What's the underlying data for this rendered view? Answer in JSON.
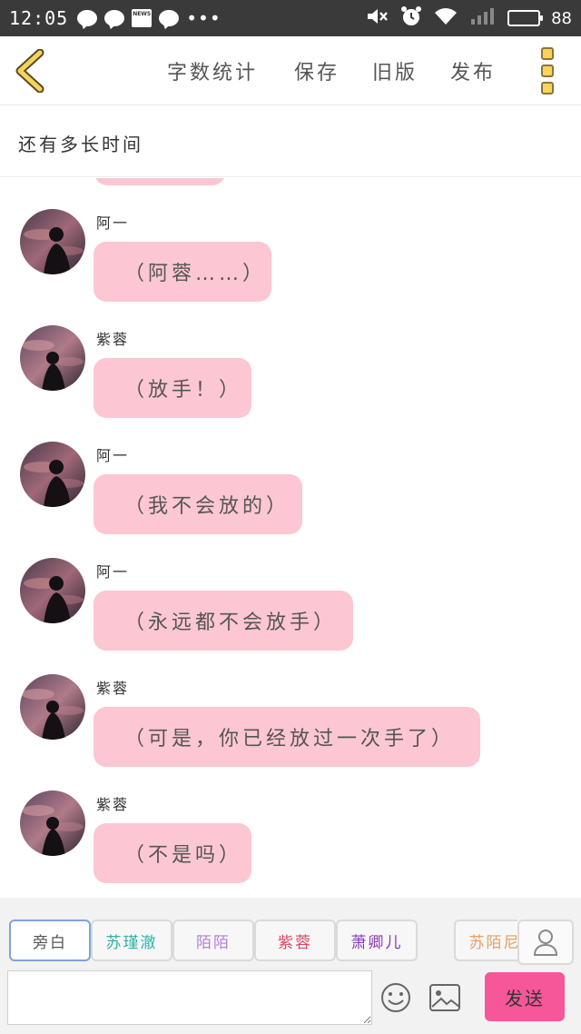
{
  "status_bar": {
    "time": "12:05",
    "notification_icons": [
      "message-bubble-icon",
      "message-bubble-icon",
      "news-icon",
      "message-bubble-icon",
      "more-dots-icon"
    ],
    "battery_level": "88"
  },
  "header": {
    "menu": [
      "字数统计",
      "保存",
      "旧版",
      "发布"
    ]
  },
  "story": {
    "title": "还有多长时间"
  },
  "messages": [
    {
      "sender": "阿一",
      "text": "（阿蓉……）",
      "avatar": "silhouette-avatar"
    },
    {
      "sender": "紫蓉",
      "text": "（放手！）",
      "avatar": "silhouette-avatar"
    },
    {
      "sender": "阿一",
      "text": "（我不会放的）",
      "avatar": "silhouette-avatar"
    },
    {
      "sender": "阿一",
      "text": "（永远都不会放手）",
      "avatar": "silhouette-avatar"
    },
    {
      "sender": "紫蓉",
      "text": "（可是，你已经放过一次手了）",
      "avatar": "silhouette-avatar"
    },
    {
      "sender": "紫蓉",
      "text": "（不是吗）",
      "avatar": "silhouette-avatar"
    }
  ],
  "roles": [
    {
      "label": "旁白",
      "color": "#555555"
    },
    {
      "label": "苏瑾澈",
      "color": "#2bb5a5"
    },
    {
      "label": "陌陌",
      "color": "#b37fd6"
    },
    {
      "label": "紫蓉",
      "color": "#d94a63"
    },
    {
      "label": "萧卿儿",
      "color": "#8b3bb0"
    },
    {
      "label": "苏陌尼",
      "color": "#e8a060"
    }
  ],
  "composer": {
    "input_value": "",
    "send_label": "发送"
  },
  "colors": {
    "bubble": "#fcc7d2",
    "send_button": "#f65799",
    "back_arrow": "#f6d45a"
  }
}
